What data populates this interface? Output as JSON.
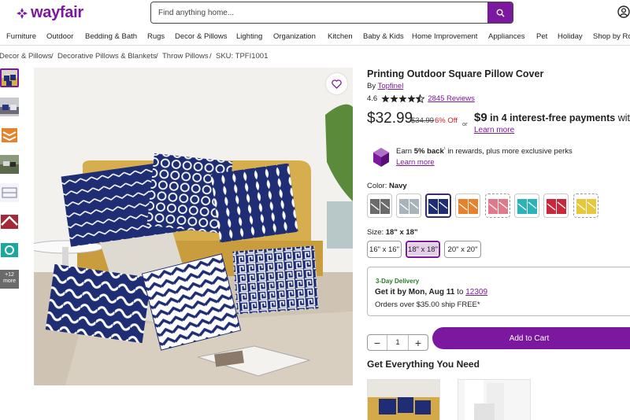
{
  "brand": {
    "name": "wayfair",
    "color": "#7b189f"
  },
  "search": {
    "placeholder": "Find anything home..."
  },
  "nav": {
    "categories": [
      "Furniture",
      "Outdoor",
      "Bedding & Bath",
      "Rugs",
      "Decor & Pillows",
      "Lighting",
      "Organization",
      "Kitchen",
      "Baby & Kids",
      "Home Improvement",
      "Appliances",
      "Pet",
      "Holiday",
      "Shop by Ro"
    ]
  },
  "breadcrumb": {
    "items": [
      "Decor & Pillows",
      "Decorative Pillows & Blankets",
      "Throw Pillows"
    ],
    "sku": "SKU: TPFI1001"
  },
  "thumbnails": {
    "more_count": "+12",
    "more_label": "more"
  },
  "product": {
    "title": "Printing Outdoor Square Pillow Cover",
    "by_label": "By",
    "brand": "Topfinel",
    "rating": "4.6",
    "reviews": "2845 Reviews",
    "price": "$32.99",
    "was_price": "$34.99",
    "discount": "6% Off",
    "or_label": "or",
    "installment_amount": "$9",
    "installment_text": " in 4 interest-free payments",
    "installment_tail": " with K",
    "learn_more": "Learn more"
  },
  "rewards": {
    "prefix": "Earn ",
    "percent": "5% back",
    "mark": "¹",
    "suffix": " in rewards, plus more exclusive perks",
    "link": "Learn more"
  },
  "color": {
    "label": "Color:",
    "selected": "Navy",
    "swatches": [
      {
        "name": "Gray",
        "hex": "#6b6b6b",
        "dashed": false
      },
      {
        "name": "Light Gray",
        "hex": "#a9b3bb",
        "dashed": false
      },
      {
        "name": "Navy",
        "hex": "#1f2e74",
        "dashed": false
      },
      {
        "name": "Orange",
        "hex": "#e8822a",
        "dashed": false
      },
      {
        "name": "Pink",
        "hex": "#e07a8a",
        "dashed": true
      },
      {
        "name": "Teal",
        "hex": "#2ab3b8",
        "dashed": false
      },
      {
        "name": "Red",
        "hex": "#c8283a",
        "dashed": false
      },
      {
        "name": "Yellow",
        "hex": "#e8c83a",
        "dashed": true
      }
    ]
  },
  "size": {
    "label": "Size:",
    "selected": "18\" x 18\"",
    "options": [
      "16\" x 16\"",
      "18\" x 18\"",
      "20\" x 20\""
    ]
  },
  "delivery": {
    "tag": "3-Day Delivery",
    "text": "Get it by Mon, Aug 11",
    "to_label": " to ",
    "zip": "12309",
    "free_text": "Orders over $35.00 ship FREE*"
  },
  "cart": {
    "qty": "1",
    "minus": "−",
    "plus": "+",
    "add_label": "Add to Cart"
  },
  "section": {
    "get_everything": "Get Everything You Need"
  }
}
